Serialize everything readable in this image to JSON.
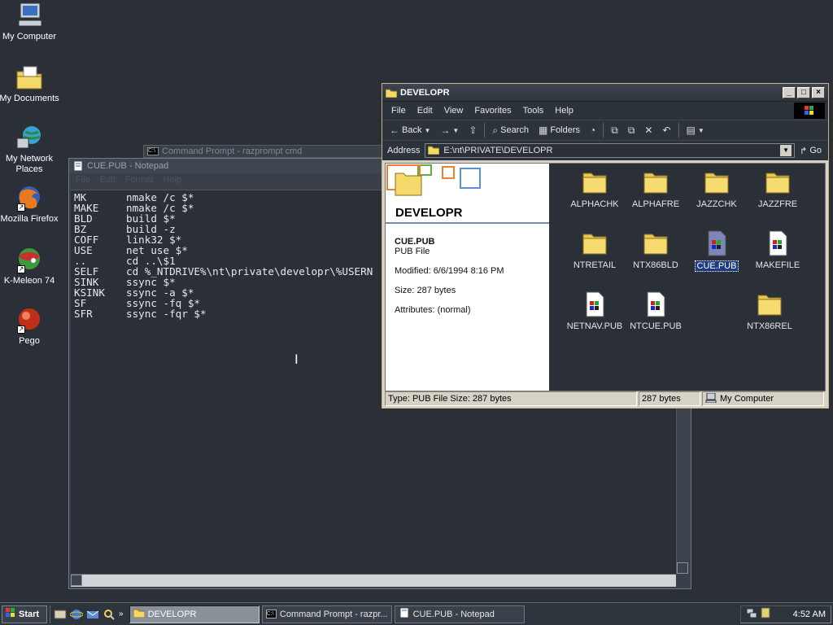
{
  "desktop": {
    "icons": [
      {
        "label": "My Computer",
        "icon": "computer-icon"
      },
      {
        "label": "My Documents",
        "icon": "documents-icon"
      },
      {
        "label": "My Network Places",
        "icon": "network-icon"
      },
      {
        "label": "Mozilla Firefox",
        "icon": "firefox-icon"
      },
      {
        "label": "K-Meleon 74",
        "icon": "kmeleon-icon"
      },
      {
        "label": "Pego",
        "icon": "pego-icon"
      }
    ]
  },
  "cmd_window": {
    "title": "Command Prompt - razprompt cmd"
  },
  "notepad": {
    "title": "CUE.PUB - Notepad",
    "menu": [
      "File",
      "Edit",
      "Format",
      "Help"
    ],
    "lines": [
      {
        "key": "MK",
        "cmd": "nmake /c $*"
      },
      {
        "key": "MAKE",
        "cmd": "nmake /c $*"
      },
      {
        "key": "BLD",
        "cmd": "build $*"
      },
      {
        "key": "BZ",
        "cmd": "build -z"
      },
      {
        "key": "COFF",
        "cmd": "link32 $*"
      },
      {
        "key": "USE",
        "cmd": "net use $*"
      },
      {
        "key": "..",
        "cmd": "cd ..\\$1"
      },
      {
        "key": "SELF",
        "cmd": "cd %_NTDRIVE%\\nt\\private\\developr\\%USERN"
      },
      {
        "key": "SINK",
        "cmd": "ssync $*"
      },
      {
        "key": "KSINK",
        "cmd": "ssync -a $*"
      },
      {
        "key": "SF",
        "cmd": "ssync -fq $*"
      },
      {
        "key": "SFR",
        "cmd": "ssync -fqr $*"
      }
    ]
  },
  "explorer": {
    "title": "DEVELOPR",
    "menu": [
      "File",
      "Edit",
      "View",
      "Favorites",
      "Tools",
      "Help"
    ],
    "toolbar": {
      "back": "Back",
      "search": "Search",
      "folders": "Folders"
    },
    "address_label": "Address",
    "address_value": "E:\\nt\\PRIVATE\\DEVELOPR",
    "go_label": "Go",
    "info": {
      "folder_name": "DEVELOPR",
      "file_name": "CUE.PUB",
      "file_type": "PUB File",
      "modified": "Modified: 6/6/1994 8:16 PM",
      "size": "Size: 287 bytes",
      "attributes": "Attributes: (normal)"
    },
    "items": [
      {
        "label": "ALPHACHK",
        "type": "folder"
      },
      {
        "label": "ALPHAFRE",
        "type": "folder"
      },
      {
        "label": "JAZZCHK",
        "type": "folder"
      },
      {
        "label": "JAZZFRE",
        "type": "folder"
      },
      {
        "label": "NTRETAIL",
        "type": "folder"
      },
      {
        "label": "NTX86BLD",
        "type": "folder"
      },
      {
        "label": "CUE.PUB",
        "type": "file",
        "selected": true
      },
      {
        "label": "MAKEFILE",
        "type": "file"
      },
      {
        "label": "NETNAV.PUB",
        "type": "file"
      },
      {
        "label": "NTCUE.PUB",
        "type": "file"
      },
      {
        "label": "NTX86REL",
        "type": "folder"
      }
    ],
    "status": {
      "left": "Type: PUB File Size: 287 bytes",
      "mid": "287 bytes",
      "right": "My Computer"
    }
  },
  "taskbar": {
    "start_label": "Start",
    "tasks": [
      {
        "label": "DEVELOPR",
        "active": true
      },
      {
        "label": "Command Prompt - razpr...",
        "active": false
      },
      {
        "label": "CUE.PUB - Notepad",
        "active": false
      }
    ],
    "clock": "4:52 AM"
  },
  "colors": {
    "desktop": "#2b3038",
    "selection": "#1d3b83",
    "folder": "#f4d86a"
  }
}
